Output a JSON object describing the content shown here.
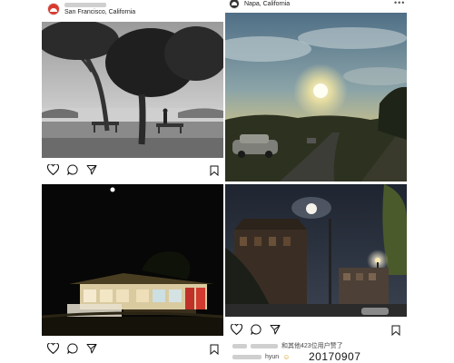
{
  "posts": [
    {
      "location": "San Francisco, California",
      "image_alt": "Black and white photo of a large tree with benches by the bay"
    },
    {
      "location": "Napa, California",
      "image_alt": "Sunset over a winding road with a parked car"
    },
    {
      "image_alt": "Small lit building at night under a dark sky"
    },
    {
      "image_alt": "Street with old buildings and street lamps at night"
    }
  ],
  "caption": {
    "likes_text": "和其他423位用户赞了",
    "comment_user": "hyun",
    "comment_emoji": "☺"
  },
  "date_stamp": "20170907",
  "icons": {
    "like": "heart-icon",
    "comment": "comment-icon",
    "share": "send-icon",
    "save": "bookmark-icon",
    "more": "more-icon"
  },
  "colors": {
    "avatar": "#d93a2f",
    "background": "#ffffff"
  }
}
